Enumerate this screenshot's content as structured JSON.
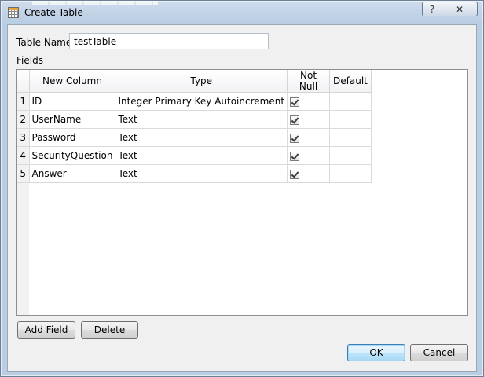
{
  "window": {
    "title": "Create Table"
  },
  "form": {
    "table_name_label": "Table Name:",
    "table_name_value": "testTable",
    "fields_label": "Fields"
  },
  "grid": {
    "columns": [
      "New Column",
      "Type",
      "Not Null",
      "Default"
    ],
    "rows": [
      {
        "num": "1",
        "name": "ID",
        "type": "Integer Primary Key Autoincrement",
        "not_null": true,
        "default": ""
      },
      {
        "num": "2",
        "name": "UserName",
        "type": "Text",
        "not_null": true,
        "default": ""
      },
      {
        "num": "3",
        "name": "Password",
        "type": "Text",
        "not_null": true,
        "default": ""
      },
      {
        "num": "4",
        "name": "SecurityQuestion",
        "type": "Text",
        "not_null": true,
        "default": ""
      },
      {
        "num": "5",
        "name": "Answer",
        "type": "Text",
        "not_null": true,
        "default": ""
      }
    ]
  },
  "buttons": {
    "add_field": "Add Field",
    "delete": "Delete",
    "ok": "OK",
    "cancel": "Cancel"
  },
  "titlebar": {
    "help_glyph": "?",
    "close_glyph": "✕"
  }
}
